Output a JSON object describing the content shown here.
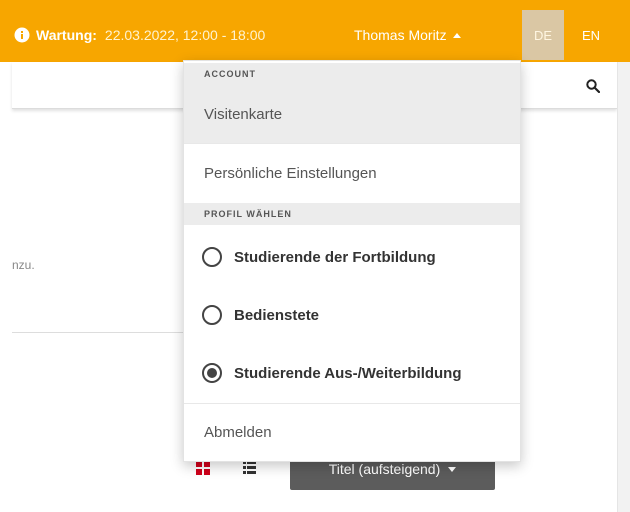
{
  "topbar": {
    "maintenance_label": "Wartung:",
    "maintenance_value": "22.03.2022, 12:00 - 18:00",
    "user_name": "Thomas Moritz",
    "languages": [
      "DE",
      "EN"
    ],
    "active_language": "DE",
    "accent_color": "#f7a600",
    "icons": {
      "info": "info-icon",
      "user_caret": "caret-up-icon"
    }
  },
  "search": {
    "icon": "search-icon"
  },
  "background": {
    "fragment_text": "nzu.",
    "sort_button_label": "Titel (aufsteigend)",
    "view_icons": [
      "grid-view-icon",
      "list-view-icon"
    ],
    "grid_icon_color": "#d0021b"
  },
  "dropdown": {
    "account_header": "ACCOUNT",
    "account_items": [
      "Visitenkarte",
      "Persönliche Einstellungen"
    ],
    "active_account_item": "Visitenkarte",
    "profile_header": "PROFIL WÄHLEN",
    "profiles": [
      {
        "label": "Studierende der Fortbildung",
        "selected": false
      },
      {
        "label": "Bedienstete",
        "selected": false
      },
      {
        "label": "Studierende Aus-/Weiterbildung",
        "selected": true
      }
    ],
    "logout_label": "Abmelden"
  }
}
